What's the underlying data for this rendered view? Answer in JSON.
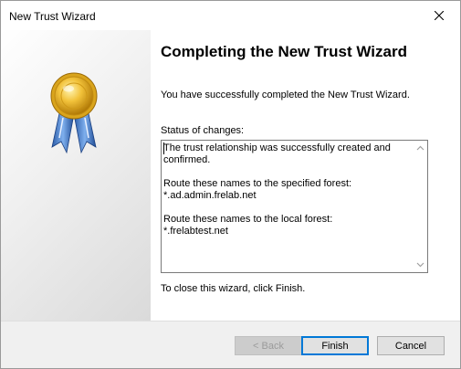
{
  "window": {
    "title": "New Trust Wizard",
    "close_icon": "close-icon"
  },
  "content": {
    "heading": "Completing the New Trust Wizard",
    "message": "You have successfully completed the New Trust Wizard.",
    "status_label": "Status of changes:",
    "status_lines": [
      "The trust relationship was successfully created and confirmed.",
      "Route these names to the specified forest:\n*.ad.admin.frelab.net",
      "Route these names to the local forest:\n*.frelabtest.net"
    ],
    "close_message": "To close this wizard, click Finish."
  },
  "buttons": {
    "back": "< Back",
    "finish": "Finish",
    "cancel": "Cancel"
  },
  "icons": {
    "medal": "award-ribbon-icon"
  },
  "colors": {
    "default_button_border": "#0078d7",
    "footer_background": "#f0f0f0"
  }
}
